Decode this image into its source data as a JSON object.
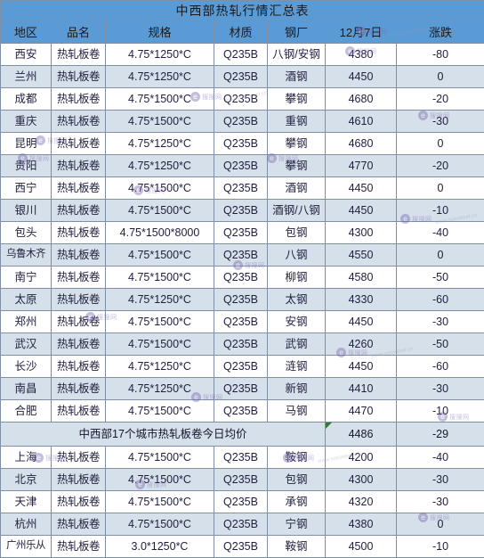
{
  "table": {
    "title": "中西部热轧行情汇总表",
    "columns": [
      "地区",
      "品名",
      "规格",
      "材质",
      "钢厂",
      "12月7日",
      "涨跌"
    ],
    "rows": [
      {
        "region": "西安",
        "product": "热轧板卷",
        "spec": "4.75*1250*C",
        "material": "Q235B",
        "mill": "八钢/安钢",
        "price": "4380",
        "change": "-80"
      },
      {
        "region": "兰州",
        "product": "热轧板卷",
        "spec": "4.75*1250*C",
        "material": "Q235B",
        "mill": "酒钢",
        "price": "4450",
        "change": "0"
      },
      {
        "region": "成都",
        "product": "热轧板卷",
        "spec": "4.75*1500*C",
        "material": "Q235B",
        "mill": "攀钢",
        "price": "4680",
        "change": "-20"
      },
      {
        "region": "重庆",
        "product": "热轧板卷",
        "spec": "4.75*1500*C",
        "material": "Q235B",
        "mill": "重钢",
        "price": "4610",
        "change": "-30"
      },
      {
        "region": "昆明",
        "product": "热轧板卷",
        "spec": "4.75*1250*C",
        "material": "Q235B",
        "mill": "攀钢",
        "price": "4680",
        "change": "0"
      },
      {
        "region": "贵阳",
        "product": "热轧板卷",
        "spec": "4.75*1250*C",
        "material": "Q235B",
        "mill": "攀钢",
        "price": "4770",
        "change": "-20"
      },
      {
        "region": "西宁",
        "product": "热轧板卷",
        "spec": "4.75*1500*C",
        "material": "Q235B",
        "mill": "酒钢",
        "price": "4450",
        "change": "0"
      },
      {
        "region": "银川",
        "product": "热轧板卷",
        "spec": "4.75*1500*C",
        "material": "Q235B",
        "mill": "酒钢/八钢",
        "price": "4450",
        "change": "-10"
      },
      {
        "region": "包头",
        "product": "热轧板卷",
        "spec": "4.75*1500*8000",
        "material": "Q235B",
        "mill": "包钢",
        "price": "4300",
        "change": "-40"
      },
      {
        "region": "乌鲁木齐",
        "product": "热轧板卷",
        "spec": "4.75*1500*C",
        "material": "Q235B",
        "mill": "八钢",
        "price": "4550",
        "change": "0"
      },
      {
        "region": "南宁",
        "product": "热轧板卷",
        "spec": "4.75*1500*C",
        "material": "Q235B",
        "mill": "柳钢",
        "price": "4580",
        "change": "-50"
      },
      {
        "region": "太原",
        "product": "热轧板卷",
        "spec": "4.75*1250*C",
        "material": "Q235B",
        "mill": "太钢",
        "price": "4330",
        "change": "-60"
      },
      {
        "region": "郑州",
        "product": "热轧板卷",
        "spec": "4.75*1500*C",
        "material": "Q235B",
        "mill": "安钢",
        "price": "4450",
        "change": "-30"
      },
      {
        "region": "武汉",
        "product": "热轧板卷",
        "spec": "4.75*1500*C",
        "material": "Q235B",
        "mill": "武钢",
        "price": "4260",
        "change": "-50"
      },
      {
        "region": "长沙",
        "product": "热轧板卷",
        "spec": "4.75*1250*C",
        "material": "Q235B",
        "mill": "涟钢",
        "price": "4450",
        "change": "-60"
      },
      {
        "region": "南昌",
        "product": "热轧板卷",
        "spec": "4.75*1250*C",
        "material": "Q235B",
        "mill": "新钢",
        "price": "4410",
        "change": "-30"
      },
      {
        "region": "合肥",
        "product": "热轧板卷",
        "spec": "4.75*1500*C",
        "material": "Q235B",
        "mill": "马钢",
        "price": "4470",
        "change": "-10"
      }
    ],
    "summary": {
      "label": "中西部17个城市热轧板卷今日均价",
      "price": "4486",
      "change": "-29"
    },
    "rows_after": [
      {
        "region": "上海",
        "product": "热轧板卷",
        "spec": "4.75*1500*C",
        "material": "Q235B",
        "mill": "鞍钢",
        "price": "4200",
        "change": "-40"
      },
      {
        "region": "北京",
        "product": "热轧板卷",
        "spec": "4.75*1500*C",
        "material": "Q235B",
        "mill": "包钢",
        "price": "4300",
        "change": "-30"
      },
      {
        "region": "天津",
        "product": "热轧板卷",
        "spec": "4.75*1500*C",
        "material": "Q235B",
        "mill": "承钢",
        "price": "4320",
        "change": "-30"
      },
      {
        "region": "杭州",
        "product": "热轧板卷",
        "spec": "4.75*1500*C",
        "material": "Q235B",
        "mill": "宁钢",
        "price": "4380",
        "change": "0"
      },
      {
        "region": "广州乐从",
        "product": "热轧板卷",
        "spec": "3.0*1250*C",
        "material": "Q235B",
        "mill": "鞍钢",
        "price": "4500",
        "change": "-10"
      }
    ],
    "colors": {
      "header_blue": "#5b9bd5",
      "band_blue": "#d6e0ea",
      "change_green": "#00a86b",
      "grid_line": "#7f8fa6"
    },
    "watermark": {
      "glyph": "e",
      "text": "搜搜网",
      "text2": "www.sososteel.cn"
    }
  }
}
